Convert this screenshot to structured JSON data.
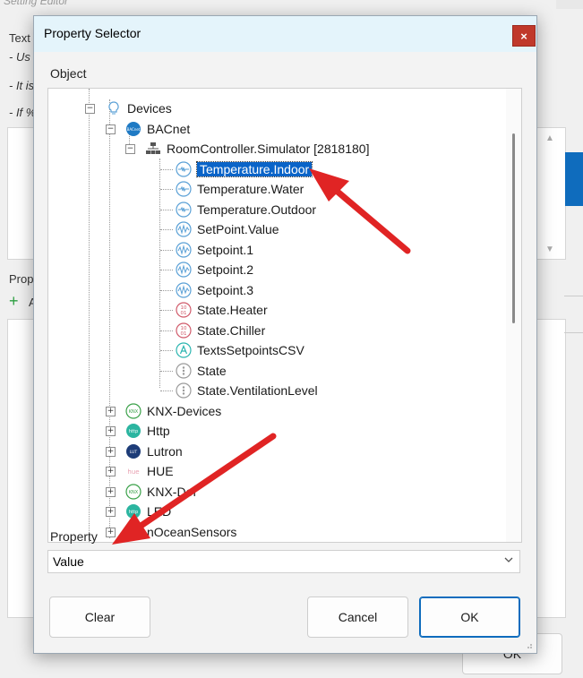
{
  "background": {
    "window_title": "Setting Editor",
    "text_label": "Text",
    "line1": "- Us",
    "line2": "- It is",
    "line3": "- If %",
    "prop_label": "Prop",
    "add_label": "A",
    "ok_label": "OK"
  },
  "dialog": {
    "title": "Property Selector",
    "close_glyph": "×",
    "object_label": "Object",
    "property_label": "Property",
    "property_value": "Value",
    "buttons": {
      "clear": "Clear",
      "cancel": "Cancel",
      "ok": "OK"
    }
  },
  "tree": {
    "items": [
      {
        "label": "Devices",
        "icon": "lightbulb-icon"
      },
      {
        "label": "BACnet",
        "icon": "bacnet-icon"
      },
      {
        "label": "RoomController.Simulator [2818180]",
        "icon": "network-icon"
      },
      {
        "label": "Temperature.Indoor",
        "icon": "analog-icon",
        "selected": true
      },
      {
        "label": "Temperature.Water",
        "icon": "analog-icon"
      },
      {
        "label": "Temperature.Outdoor",
        "icon": "analog-icon"
      },
      {
        "label": "SetPoint.Value",
        "icon": "wave-icon"
      },
      {
        "label": "Setpoint.1",
        "icon": "wave-icon"
      },
      {
        "label": "Setpoint.2",
        "icon": "wave-icon"
      },
      {
        "label": "Setpoint.3",
        "icon": "wave-icon"
      },
      {
        "label": "State.Heater",
        "icon": "binary-icon"
      },
      {
        "label": "State.Chiller",
        "icon": "binary-icon"
      },
      {
        "label": "TextsSetpointsCSV",
        "icon": "text-icon"
      },
      {
        "label": "State",
        "icon": "multistate-icon"
      },
      {
        "label": "State.VentilationLevel",
        "icon": "multistate-icon"
      },
      {
        "label": "KNX-Devices",
        "icon": "knx-icon"
      },
      {
        "label": "Http",
        "icon": "http-icon"
      },
      {
        "label": "Lutron",
        "icon": "lutron-icon"
      },
      {
        "label": "HUE",
        "icon": "hue-icon"
      },
      {
        "label": "KNX-Def",
        "icon": "knx-icon"
      },
      {
        "label": "LED",
        "icon": "http-icon"
      },
      {
        "label": "nOceanSensors",
        "icon": "enocean-icon"
      }
    ]
  },
  "icon_text": {
    "bacnet": "BACnet",
    "knx": "KNX",
    "http": "http",
    "lutron": "LUT",
    "hue": "hue",
    "binary": "10\n01"
  },
  "colors": {
    "accent": "#0f6cbd",
    "selection": "#0a64c8",
    "close": "#c0392b",
    "titlebar": "#e4f4fb",
    "arrow": "#e02424"
  }
}
